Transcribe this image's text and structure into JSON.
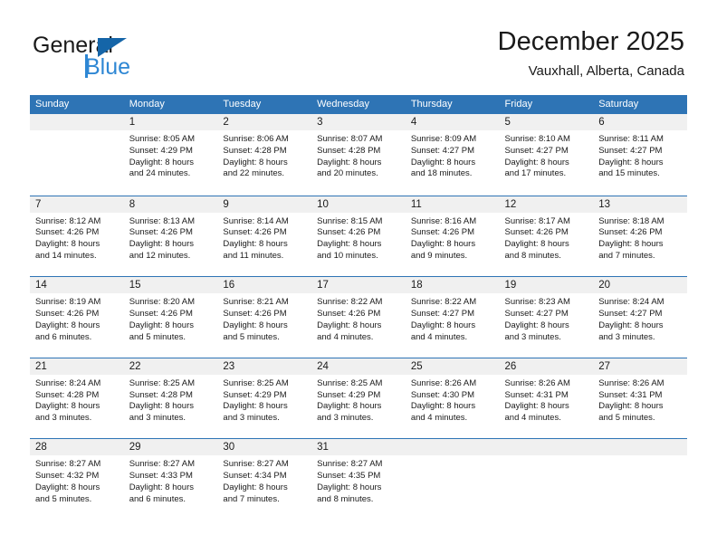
{
  "brand": {
    "name_part1": "General",
    "name_part2": "Blue"
  },
  "header": {
    "title": "December 2025",
    "subtitle": "Vauxhall, Alberta, Canada"
  },
  "colors": {
    "header_blue": "#2E74B5",
    "brand_blue": "#2E87D4",
    "daynum_band": "#f0f0f0"
  },
  "weekday_names": [
    "Sunday",
    "Monday",
    "Tuesday",
    "Wednesday",
    "Thursday",
    "Friday",
    "Saturday"
  ],
  "weeks": [
    [
      {
        "day": "",
        "sunrise": "",
        "sunset": "",
        "daylight1": "",
        "daylight2": ""
      },
      {
        "day": "1",
        "sunrise": "Sunrise: 8:05 AM",
        "sunset": "Sunset: 4:29 PM",
        "daylight1": "Daylight: 8 hours",
        "daylight2": "and 24 minutes."
      },
      {
        "day": "2",
        "sunrise": "Sunrise: 8:06 AM",
        "sunset": "Sunset: 4:28 PM",
        "daylight1": "Daylight: 8 hours",
        "daylight2": "and 22 minutes."
      },
      {
        "day": "3",
        "sunrise": "Sunrise: 8:07 AM",
        "sunset": "Sunset: 4:28 PM",
        "daylight1": "Daylight: 8 hours",
        "daylight2": "and 20 minutes."
      },
      {
        "day": "4",
        "sunrise": "Sunrise: 8:09 AM",
        "sunset": "Sunset: 4:27 PM",
        "daylight1": "Daylight: 8 hours",
        "daylight2": "and 18 minutes."
      },
      {
        "day": "5",
        "sunrise": "Sunrise: 8:10 AM",
        "sunset": "Sunset: 4:27 PM",
        "daylight1": "Daylight: 8 hours",
        "daylight2": "and 17 minutes."
      },
      {
        "day": "6",
        "sunrise": "Sunrise: 8:11 AM",
        "sunset": "Sunset: 4:27 PM",
        "daylight1": "Daylight: 8 hours",
        "daylight2": "and 15 minutes."
      }
    ],
    [
      {
        "day": "7",
        "sunrise": "Sunrise: 8:12 AM",
        "sunset": "Sunset: 4:26 PM",
        "daylight1": "Daylight: 8 hours",
        "daylight2": "and 14 minutes."
      },
      {
        "day": "8",
        "sunrise": "Sunrise: 8:13 AM",
        "sunset": "Sunset: 4:26 PM",
        "daylight1": "Daylight: 8 hours",
        "daylight2": "and 12 minutes."
      },
      {
        "day": "9",
        "sunrise": "Sunrise: 8:14 AM",
        "sunset": "Sunset: 4:26 PM",
        "daylight1": "Daylight: 8 hours",
        "daylight2": "and 11 minutes."
      },
      {
        "day": "10",
        "sunrise": "Sunrise: 8:15 AM",
        "sunset": "Sunset: 4:26 PM",
        "daylight1": "Daylight: 8 hours",
        "daylight2": "and 10 minutes."
      },
      {
        "day": "11",
        "sunrise": "Sunrise: 8:16 AM",
        "sunset": "Sunset: 4:26 PM",
        "daylight1": "Daylight: 8 hours",
        "daylight2": "and 9 minutes."
      },
      {
        "day": "12",
        "sunrise": "Sunrise: 8:17 AM",
        "sunset": "Sunset: 4:26 PM",
        "daylight1": "Daylight: 8 hours",
        "daylight2": "and 8 minutes."
      },
      {
        "day": "13",
        "sunrise": "Sunrise: 8:18 AM",
        "sunset": "Sunset: 4:26 PM",
        "daylight1": "Daylight: 8 hours",
        "daylight2": "and 7 minutes."
      }
    ],
    [
      {
        "day": "14",
        "sunrise": "Sunrise: 8:19 AM",
        "sunset": "Sunset: 4:26 PM",
        "daylight1": "Daylight: 8 hours",
        "daylight2": "and 6 minutes."
      },
      {
        "day": "15",
        "sunrise": "Sunrise: 8:20 AM",
        "sunset": "Sunset: 4:26 PM",
        "daylight1": "Daylight: 8 hours",
        "daylight2": "and 5 minutes."
      },
      {
        "day": "16",
        "sunrise": "Sunrise: 8:21 AM",
        "sunset": "Sunset: 4:26 PM",
        "daylight1": "Daylight: 8 hours",
        "daylight2": "and 5 minutes."
      },
      {
        "day": "17",
        "sunrise": "Sunrise: 8:22 AM",
        "sunset": "Sunset: 4:26 PM",
        "daylight1": "Daylight: 8 hours",
        "daylight2": "and 4 minutes."
      },
      {
        "day": "18",
        "sunrise": "Sunrise: 8:22 AM",
        "sunset": "Sunset: 4:27 PM",
        "daylight1": "Daylight: 8 hours",
        "daylight2": "and 4 minutes."
      },
      {
        "day": "19",
        "sunrise": "Sunrise: 8:23 AM",
        "sunset": "Sunset: 4:27 PM",
        "daylight1": "Daylight: 8 hours",
        "daylight2": "and 3 minutes."
      },
      {
        "day": "20",
        "sunrise": "Sunrise: 8:24 AM",
        "sunset": "Sunset: 4:27 PM",
        "daylight1": "Daylight: 8 hours",
        "daylight2": "and 3 minutes."
      }
    ],
    [
      {
        "day": "21",
        "sunrise": "Sunrise: 8:24 AM",
        "sunset": "Sunset: 4:28 PM",
        "daylight1": "Daylight: 8 hours",
        "daylight2": "and 3 minutes."
      },
      {
        "day": "22",
        "sunrise": "Sunrise: 8:25 AM",
        "sunset": "Sunset: 4:28 PM",
        "daylight1": "Daylight: 8 hours",
        "daylight2": "and 3 minutes."
      },
      {
        "day": "23",
        "sunrise": "Sunrise: 8:25 AM",
        "sunset": "Sunset: 4:29 PM",
        "daylight1": "Daylight: 8 hours",
        "daylight2": "and 3 minutes."
      },
      {
        "day": "24",
        "sunrise": "Sunrise: 8:25 AM",
        "sunset": "Sunset: 4:29 PM",
        "daylight1": "Daylight: 8 hours",
        "daylight2": "and 3 minutes."
      },
      {
        "day": "25",
        "sunrise": "Sunrise: 8:26 AM",
        "sunset": "Sunset: 4:30 PM",
        "daylight1": "Daylight: 8 hours",
        "daylight2": "and 4 minutes."
      },
      {
        "day": "26",
        "sunrise": "Sunrise: 8:26 AM",
        "sunset": "Sunset: 4:31 PM",
        "daylight1": "Daylight: 8 hours",
        "daylight2": "and 4 minutes."
      },
      {
        "day": "27",
        "sunrise": "Sunrise: 8:26 AM",
        "sunset": "Sunset: 4:31 PM",
        "daylight1": "Daylight: 8 hours",
        "daylight2": "and 5 minutes."
      }
    ],
    [
      {
        "day": "28",
        "sunrise": "Sunrise: 8:27 AM",
        "sunset": "Sunset: 4:32 PM",
        "daylight1": "Daylight: 8 hours",
        "daylight2": "and 5 minutes."
      },
      {
        "day": "29",
        "sunrise": "Sunrise: 8:27 AM",
        "sunset": "Sunset: 4:33 PM",
        "daylight1": "Daylight: 8 hours",
        "daylight2": "and 6 minutes."
      },
      {
        "day": "30",
        "sunrise": "Sunrise: 8:27 AM",
        "sunset": "Sunset: 4:34 PM",
        "daylight1": "Daylight: 8 hours",
        "daylight2": "and 7 minutes."
      },
      {
        "day": "31",
        "sunrise": "Sunrise: 8:27 AM",
        "sunset": "Sunset: 4:35 PM",
        "daylight1": "Daylight: 8 hours",
        "daylight2": "and 8 minutes."
      },
      {
        "day": "",
        "sunrise": "",
        "sunset": "",
        "daylight1": "",
        "daylight2": ""
      },
      {
        "day": "",
        "sunrise": "",
        "sunset": "",
        "daylight1": "",
        "daylight2": ""
      },
      {
        "day": "",
        "sunrise": "",
        "sunset": "",
        "daylight1": "",
        "daylight2": ""
      }
    ]
  ]
}
